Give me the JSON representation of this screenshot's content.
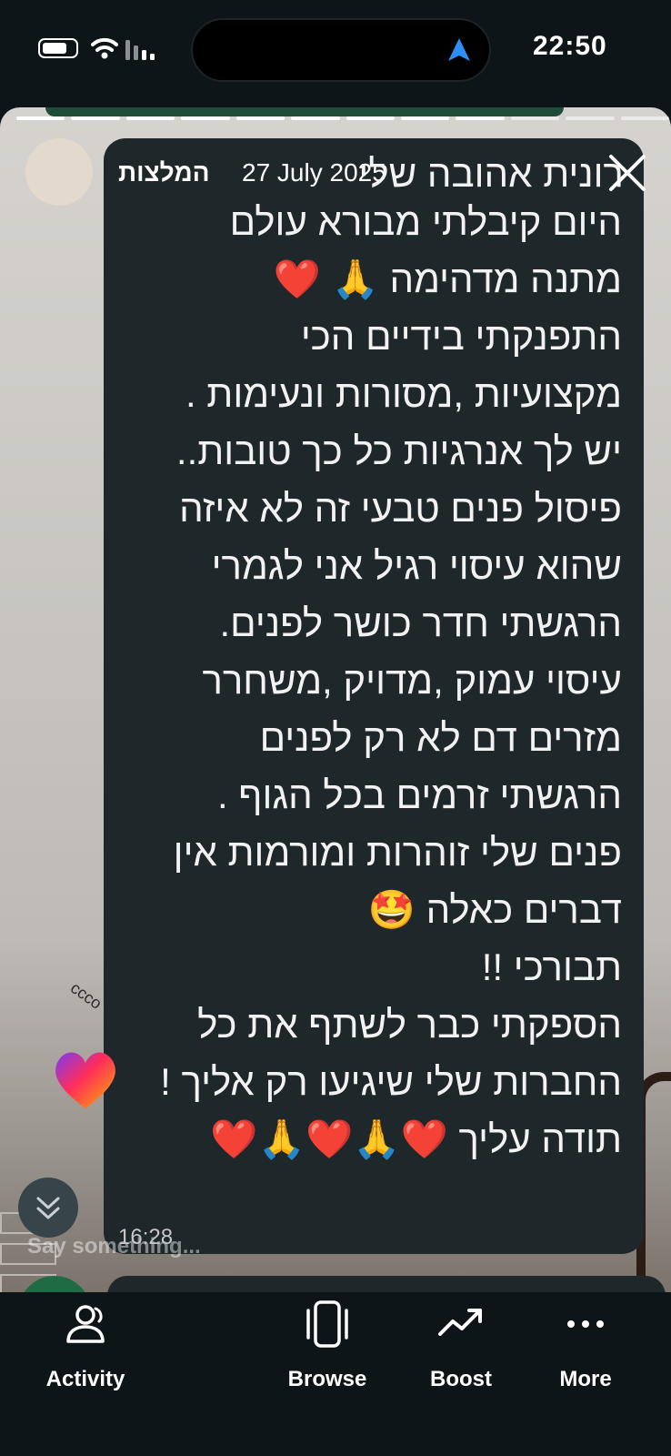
{
  "status_bar": {
    "time": "22:50",
    "icons": [
      "battery-icon",
      "wifi-icon",
      "signal-icon",
      "location-arrow-icon"
    ]
  },
  "story": {
    "author": "המלצות",
    "date": "27 July 2025",
    "message_lines": [
      "היום קיבלתי מבורא עולם",
      "מתנה מדהימה 🙏 ❤️",
      "התפנקתי בידיים הכי",
      "מקצועיות ,מסורות ונעימות .",
      "יש לך אנרגיות כל כך טובות..",
      "פיסול פנים טבעי זה לא איזה",
      "שהוא עיסוי רגיל אני לגמרי",
      "הרגשתי חדר כושר לפנים.",
      "עיסוי עמוק ,מדויק ,משחרר",
      "מזרים דם לא רק לפנים",
      "הרגשתי זרמים בכל הגוף .",
      "פנים שלי זוהרות ומורמות אין",
      "דברים כאלה 🤩",
      "תבורכי !!",
      "הספקתי כבר לשתף את כל",
      "החברות שלי שיגיעו רק אליך !",
      "תודה עליך ❤️🙏❤️🙏❤️"
    ],
    "first_line": "רונית אהובה שלי",
    "message_time": "16:28",
    "composer_placeholder": "Say something..."
  },
  "tab_bar": {
    "tabs": [
      {
        "label": "Activity",
        "icon": "activity-icon"
      },
      {
        "label": "Browse",
        "icon": "browse-icon"
      },
      {
        "label": "Boost",
        "icon": "boost-icon"
      },
      {
        "label": "More",
        "icon": "more-icon"
      }
    ]
  }
}
